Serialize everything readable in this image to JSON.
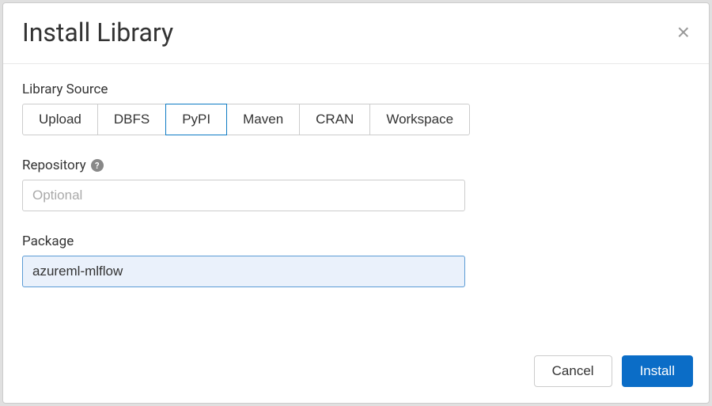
{
  "dialog": {
    "title": "Install Library"
  },
  "librarySource": {
    "label": "Library Source",
    "tabs": [
      "Upload",
      "DBFS",
      "PyPI",
      "Maven",
      "CRAN",
      "Workspace"
    ],
    "active": "PyPI"
  },
  "repository": {
    "label": "Repository",
    "placeholder": "Optional",
    "value": ""
  },
  "package": {
    "label": "Package",
    "value": "azureml-mlflow"
  },
  "buttons": {
    "cancel": "Cancel",
    "install": "Install"
  }
}
